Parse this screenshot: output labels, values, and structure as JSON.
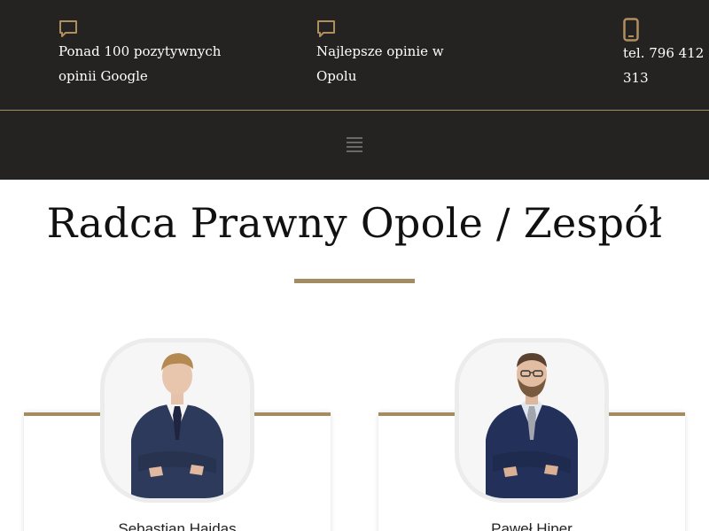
{
  "header": {
    "items": [
      {
        "icon": "chat-bubble-icon",
        "text_line1": "Ponad 100 pozytywnych",
        "text_line2": "opinii Google"
      },
      {
        "icon": "chat-bubble-icon",
        "text_line1": "Najlepsze opinie w",
        "text_line2": "Opolu"
      },
      {
        "icon": "mobile-phone-icon",
        "text_line1": "tel. 796 412",
        "text_line2": "313"
      }
    ],
    "accent_color": "#a88f63",
    "background_color": "#242321"
  },
  "nav": {
    "menu_icon": "hamburger-menu-icon"
  },
  "page": {
    "title": "Radca Prawny Opole / Zespół"
  },
  "team": [
    {
      "name": "Sebastian Hajdas",
      "photo_icon": "person-portrait"
    },
    {
      "name": "Paweł Hiper",
      "photo_icon": "person-portrait"
    }
  ]
}
